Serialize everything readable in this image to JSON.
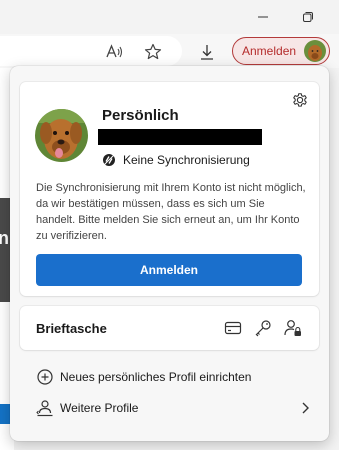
{
  "toolbar": {
    "signin_label": "Anmelden"
  },
  "page": {
    "dark_banner_letter": "n"
  },
  "profile": {
    "name": "Persönlich",
    "sync_status": "Keine Synchronisierung",
    "message": "Die Synchronisierung mit Ihrem Konto ist nicht möglich, da wir bestätigen müssen, dass es sich um Sie handelt. Bitte melden Sie sich erneut an, um Ihr Konto zu verifizieren.",
    "signin_button": "Anmelden"
  },
  "wallet": {
    "title": "Brieftasche"
  },
  "menu": {
    "new_profile": "Neues persönliches Profil einrichten",
    "more_profiles": "Weitere Profile"
  },
  "colors": {
    "accent": "#1a6fcc",
    "signin_border": "#b33a3a",
    "signin_bg": "#f7e6e6"
  },
  "icons": [
    "minimize-icon",
    "maximize-icon",
    "read-aloud-icon",
    "favorite-star-icon",
    "downloads-icon",
    "settings-gear-icon",
    "sync-off-icon",
    "payment-card-icon",
    "key-icon",
    "user-lock-icon",
    "add-circle-icon",
    "profiles-icon",
    "chevron-right-icon"
  ]
}
